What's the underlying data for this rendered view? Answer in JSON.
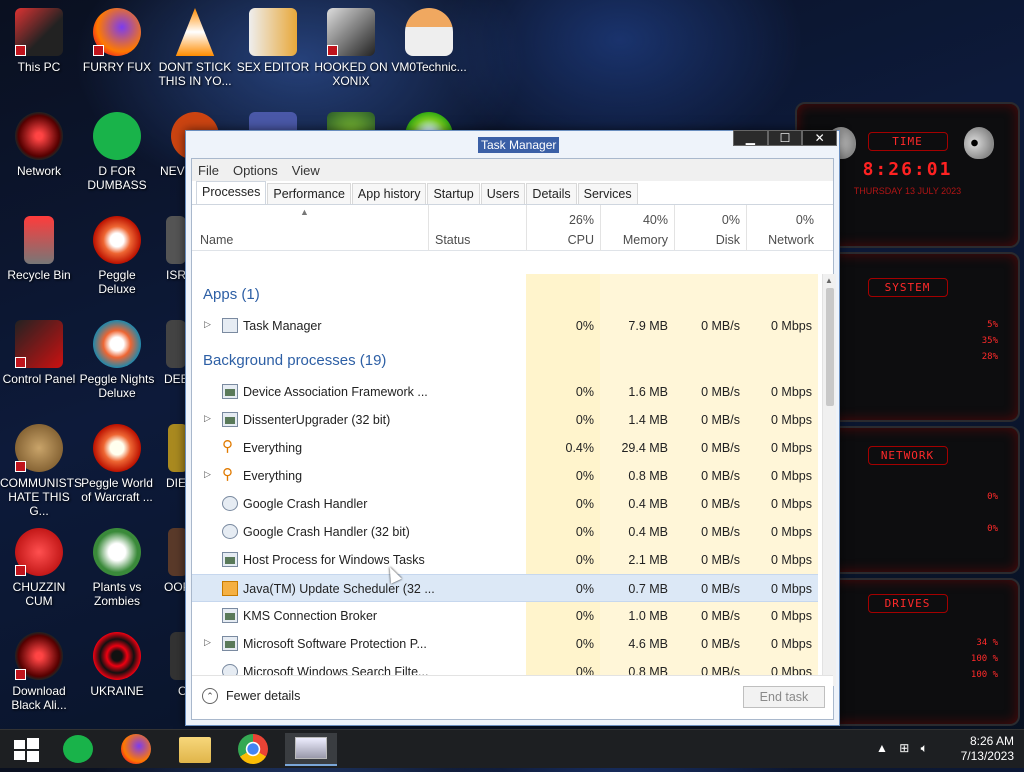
{
  "desktop": {
    "icons": [
      {
        "label": "This PC"
      },
      {
        "label": "FURRY FUX"
      },
      {
        "label": "DONT STICK THIS IN YO..."
      },
      {
        "label": "SEX EDITOR"
      },
      {
        "label": "HOOKED ON XONIX"
      },
      {
        "label": "VM0Technic..."
      },
      {
        "label": "Network"
      },
      {
        "label": "D FOR DUMBASS"
      },
      {
        "label": "NEVE"
      },
      {
        "label": "Recycle Bin"
      },
      {
        "label": "Peggle Deluxe"
      },
      {
        "label": "ISRA"
      },
      {
        "label": "Control Panel"
      },
      {
        "label": "Peggle Nights Deluxe"
      },
      {
        "label": "DEEZ"
      },
      {
        "label": "COMMUNISTS HATE THIS G..."
      },
      {
        "label": "Peggle World of Warcraft ..."
      },
      {
        "label": "DIE F"
      },
      {
        "label": "CHUZZIN CUM"
      },
      {
        "label": "Plants vs Zombies"
      },
      {
        "label": "OOP DO"
      },
      {
        "label": "Download Black Ali..."
      },
      {
        "label": "UKRAINE"
      },
      {
        "label": "O"
      }
    ]
  },
  "gadget": {
    "time_title": "TIME",
    "clock": "8:26:01",
    "date": "THURSDAY 13 JULY 2023",
    "system_title": "SYSTEM",
    "system_vals": [
      "5%",
      "35%",
      "28%"
    ],
    "network_title": "NETWORK",
    "network_vals": [
      "0%",
      "0%"
    ],
    "drives_title": "DRIVES",
    "drives_vals": [
      "34 %",
      "100 %",
      "100 %"
    ]
  },
  "window": {
    "title": "Task Manager",
    "buttons": {
      "minimize": "▁",
      "maximize": "☐",
      "close": "✕"
    },
    "menu": [
      "File",
      "Options",
      "View"
    ],
    "tabs": [
      "Processes",
      "Performance",
      "App history",
      "Startup",
      "Users",
      "Details",
      "Services"
    ],
    "header": {
      "name": "Name",
      "status": "Status",
      "cpu_pct": "26%",
      "cpu": "CPU",
      "mem_pct": "40%",
      "mem": "Memory",
      "disk_pct": "0%",
      "disk": "Disk",
      "net_pct": "0%",
      "net": "Network"
    },
    "groups": {
      "apps": "Apps (1)",
      "background": "Background processes (19)"
    },
    "apps": [
      {
        "name": "Task Manager",
        "cpu": "0%",
        "mem": "7.9 MB",
        "disk": "0 MB/s",
        "net": "0 Mbps"
      }
    ],
    "background": [
      {
        "name": "Device Association Framework ...",
        "cpu": "0%",
        "mem": "1.6 MB",
        "disk": "0 MB/s",
        "net": "0 Mbps"
      },
      {
        "name": "DissenterUpgrader (32 bit)",
        "cpu": "0%",
        "mem": "1.4 MB",
        "disk": "0 MB/s",
        "net": "0 Mbps"
      },
      {
        "name": "Everything",
        "cpu": "0.4%",
        "mem": "29.4 MB",
        "disk": "0 MB/s",
        "net": "0 Mbps"
      },
      {
        "name": "Everything",
        "cpu": "0%",
        "mem": "0.8 MB",
        "disk": "0 MB/s",
        "net": "0 Mbps"
      },
      {
        "name": "Google Crash Handler",
        "cpu": "0%",
        "mem": "0.4 MB",
        "disk": "0 MB/s",
        "net": "0 Mbps"
      },
      {
        "name": "Google Crash Handler (32 bit)",
        "cpu": "0%",
        "mem": "0.4 MB",
        "disk": "0 MB/s",
        "net": "0 Mbps"
      },
      {
        "name": "Host Process for Windows Tasks",
        "cpu": "0%",
        "mem": "2.1 MB",
        "disk": "0 MB/s",
        "net": "0 Mbps"
      },
      {
        "name": "Java(TM) Update Scheduler (32 ...",
        "cpu": "0%",
        "mem": "0.7 MB",
        "disk": "0 MB/s",
        "net": "0 Mbps"
      },
      {
        "name": "KMS Connection Broker",
        "cpu": "0%",
        "mem": "1.0 MB",
        "disk": "0 MB/s",
        "net": "0 Mbps"
      },
      {
        "name": "Microsoft Software Protection P...",
        "cpu": "0%",
        "mem": "4.6 MB",
        "disk": "0 MB/s",
        "net": "0 Mbps"
      },
      {
        "name": "Microsoft Windows Search Filte...",
        "cpu": "0%",
        "mem": "0.8 MB",
        "disk": "0 MB/s",
        "net": "0 Mbps"
      }
    ],
    "footer": {
      "fewer_details": "Fewer details",
      "end_task": "End task"
    }
  },
  "taskbar": {
    "time": "8:26 AM",
    "date": "7/13/2023"
  }
}
